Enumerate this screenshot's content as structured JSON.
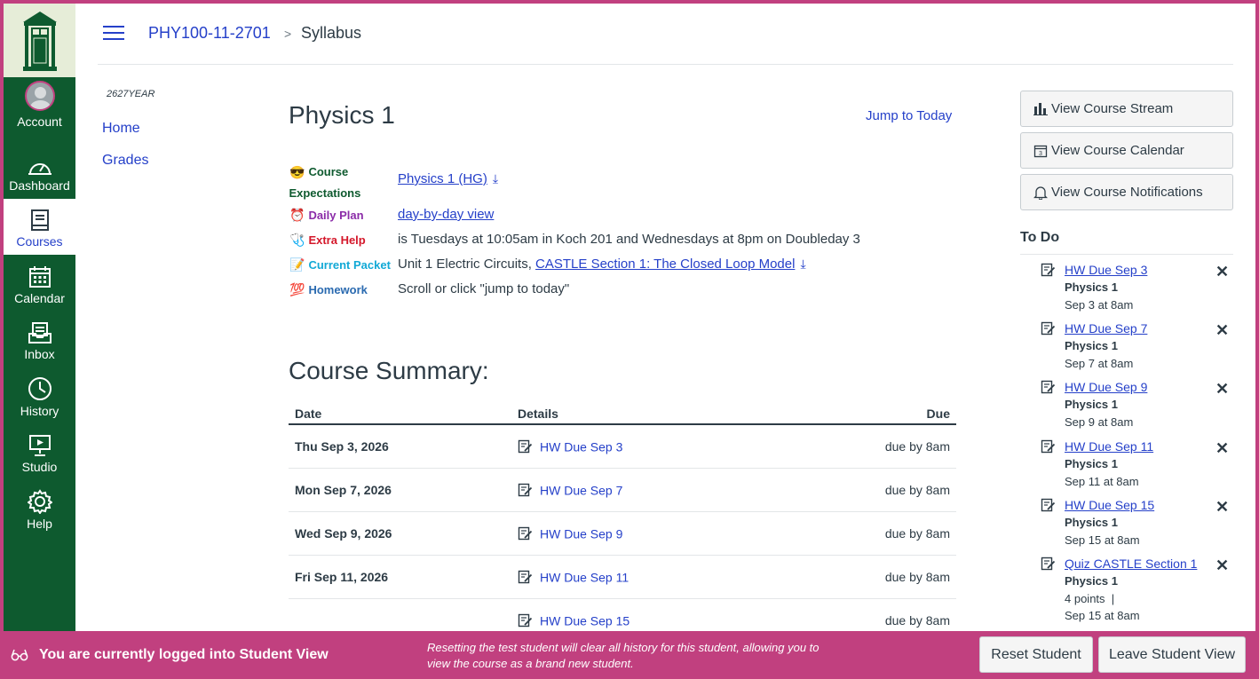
{
  "global_nav": {
    "items": [
      {
        "label": "Account",
        "icon": "avatar"
      },
      {
        "label": "Dashboard",
        "icon": "dashboard-icon"
      },
      {
        "label": "Courses",
        "icon": "courses-icon",
        "active": true
      },
      {
        "label": "Calendar",
        "icon": "calendar-icon"
      },
      {
        "label": "Inbox",
        "icon": "inbox-icon"
      },
      {
        "label": "History",
        "icon": "history-icon"
      },
      {
        "label": "Studio",
        "icon": "studio-icon"
      },
      {
        "label": "Help",
        "icon": "help-icon"
      }
    ]
  },
  "breadcrumb": {
    "course": "PHY100-11-2701",
    "separator": ">",
    "page": "Syllabus"
  },
  "course_nav": {
    "term": "2627YEAR",
    "items": [
      "Home",
      "Grades"
    ]
  },
  "main": {
    "title": "Physics 1",
    "jump_link": "Jump to Today",
    "info": [
      {
        "emoji": "😎",
        "label_line1": "Course",
        "label_line2": "Expectations",
        "color": "#0e5a2f",
        "link": "Physics 1 (HG)",
        "download": "⤓"
      },
      {
        "emoji": "⏰",
        "label": "Daily Plan",
        "color": "#8b2ca8",
        "link": "day-by-day view"
      },
      {
        "emoji": "🩺",
        "label": "Extra Help",
        "color": "#d4172a",
        "text": "is Tuesdays at 10:05am in Koch 201 and Wednesdays at 8pm on Doubleday 3"
      },
      {
        "emoji": "📝",
        "label": "Current Packet",
        "color": "#12a9d6",
        "text": "Unit 1 Electric Circuits, ",
        "link": "CASTLE Section 1: The Closed Loop Model",
        "download": "⤓"
      },
      {
        "emoji": "💯",
        "label": "Homework",
        "color": "#2a6ab0",
        "text": "Scroll or click \"jump to today\""
      }
    ],
    "summary_title": "Course Summary:",
    "summary_headers": {
      "date": "Date",
      "details": "Details",
      "due": "Due"
    },
    "summary_rows": [
      {
        "date": "Thu Sep 3, 2026",
        "details": "HW Due Sep 3",
        "due": "due by 8am"
      },
      {
        "date": "Mon Sep 7, 2026",
        "details": "HW Due Sep 7",
        "due": "due by 8am"
      },
      {
        "date": "Wed Sep 9, 2026",
        "details": "HW Due Sep 9",
        "due": "due by 8am"
      },
      {
        "date": "Fri Sep 11, 2026",
        "details": "HW Due Sep 11",
        "due": "due by 8am"
      },
      {
        "date": "",
        "details": "HW Due Sep 15",
        "due": "due by 8am"
      }
    ]
  },
  "sidebar": {
    "buttons": [
      "View Course Stream",
      "View Course Calendar",
      "View Course Notifications"
    ],
    "todo_title": "To Do",
    "todo": [
      {
        "title": "HW Due Sep 3",
        "course": "Physics 1",
        "date": "Sep 3 at 8am"
      },
      {
        "title": "HW Due Sep 7",
        "course": "Physics 1",
        "date": "Sep 7 at 8am"
      },
      {
        "title": "HW Due Sep 9",
        "course": "Physics 1",
        "date": "Sep 9 at 8am"
      },
      {
        "title": "HW Due Sep 11",
        "course": "Physics 1",
        "date": "Sep 11 at 8am"
      },
      {
        "title": "HW Due Sep 15",
        "course": "Physics 1",
        "date": "Sep 15 at 8am"
      },
      {
        "title": "Quiz CASTLE Section 1",
        "course": "Physics 1",
        "points": "4 points  |",
        "date": "Sep 15 at 8am"
      }
    ],
    "close_glyph": "✕"
  },
  "student_bar": {
    "message": "You are currently logged into Student View",
    "note": "Resetting the test student will clear all history for this student, allowing you to view the course as a brand new student.",
    "reset_label": "Reset Student",
    "leave_label": "Leave Student View"
  },
  "colors": {
    "brand_green": "#0e5a2f",
    "link_blue": "#2540c9",
    "student_bar": "#c1407f"
  }
}
